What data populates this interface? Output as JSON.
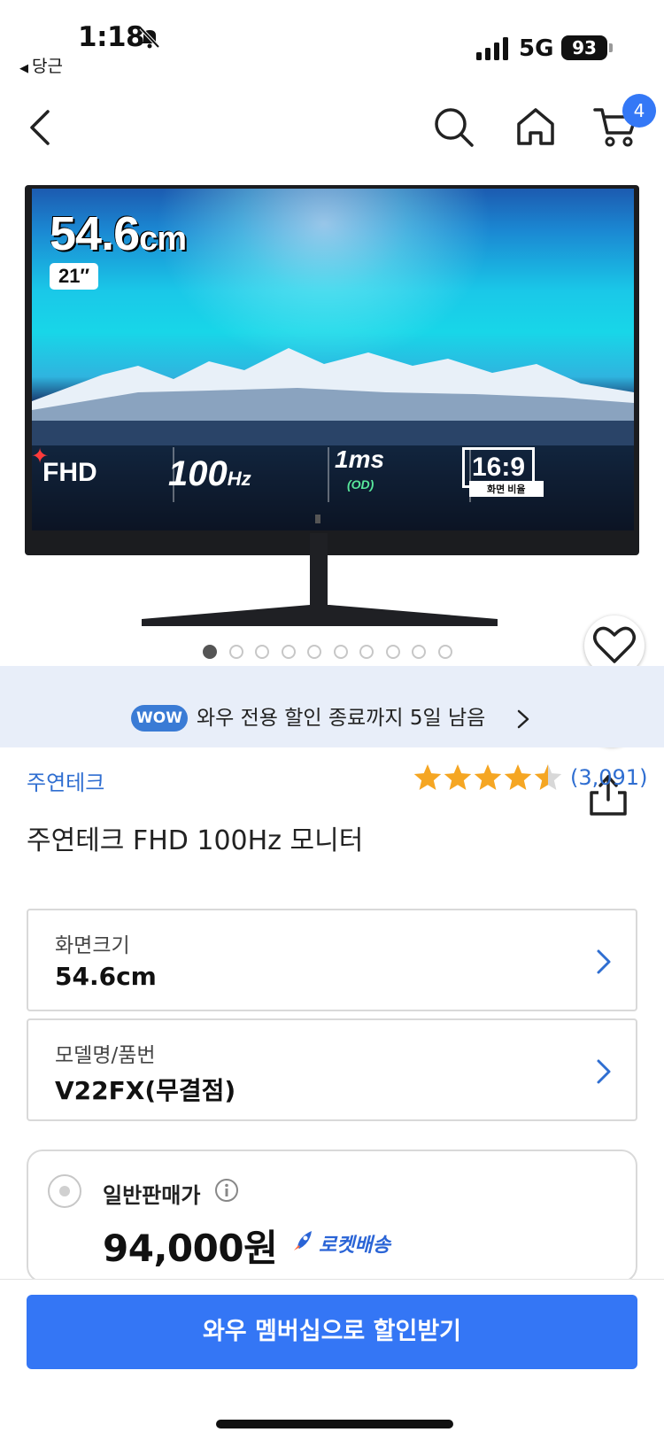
{
  "status_bar": {
    "time": "1:18",
    "back_app": "당근",
    "network": "5G",
    "battery": "93",
    "icons": [
      "bell-off-icon",
      "signal-icon",
      "battery-icon"
    ]
  },
  "nav": {
    "icons": [
      "back-arrow-icon",
      "search-icon",
      "home-icon",
      "cart-icon"
    ],
    "cart_count": "4"
  },
  "product_image": {
    "spec_size": "54.6",
    "spec_size_unit": "cm",
    "spec_inch": "21″",
    "resolution": "FHD",
    "refresh_rate": "100",
    "refresh_unit": "Hz",
    "response_time": "1ms",
    "response_sub": "(OD)",
    "aspect_ratio": "16:9",
    "aspect_label": "화면 비율",
    "total_images": 10,
    "active_image": 1
  },
  "wow_banner": {
    "badge": "WOW",
    "text": "와우 전용 할인 종료까지 5일 남음"
  },
  "product": {
    "brand": "주연테크",
    "rating": 4.5,
    "rating_count": "(3,091)",
    "title": "주연테크 FHD 100Hz 모니터"
  },
  "options": [
    {
      "label": "화면크기",
      "value": "54.6cm"
    },
    {
      "label": "모델명/품번",
      "value": "V22FX(무결점)"
    }
  ],
  "price": {
    "label": "일반판매가",
    "value": "94,000원",
    "delivery": "로켓배송"
  },
  "cta": {
    "label": "와우 멤버십으로 할인받기"
  },
  "colors": {
    "accent": "#3476f5",
    "link": "#2f6ed1",
    "star": "#f5a623",
    "banner_bg": "#e8eef9"
  }
}
